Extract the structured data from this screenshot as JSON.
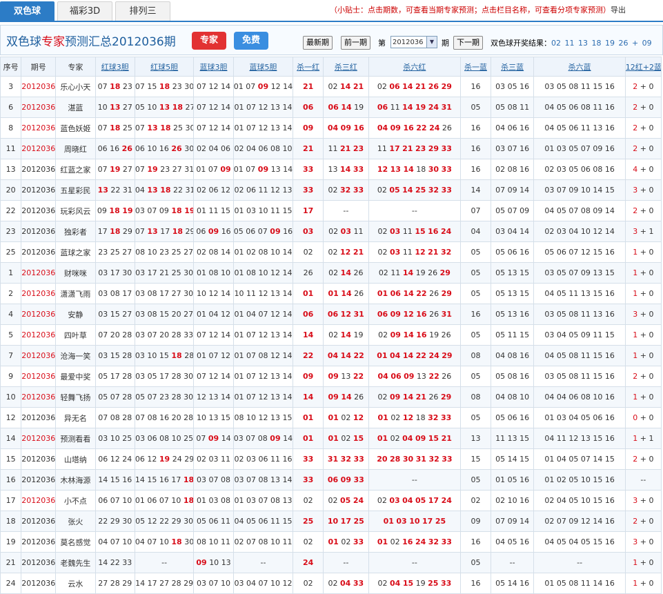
{
  "tabs": [
    "双色球",
    "福彩3D",
    "排列三"
  ],
  "tip": {
    "text": "（小贴士：点击期数，可查看当期专家预测；点击栏目名称，可查看分项专家预测）",
    "exit": "导出"
  },
  "header": {
    "title_prefix": "双色球",
    "title_red": "专家",
    "title_suffix": "预测汇总2012036期",
    "btn_expert": "专家",
    "btn_free": "免费",
    "newest": "最新期",
    "prev": "前一期",
    "di": "第",
    "period_select": "2012036",
    "qi": "期",
    "next": "下一期",
    "result_label": "双色球开奖结果：",
    "result_nums": "02 11 13 18 19 26 + 09"
  },
  "columns": [
    "序号",
    "期号",
    "专家",
    "红球3胆",
    "红球5胆",
    "蓝球3胆",
    "蓝球5胆",
    "杀一红",
    "杀三红",
    "杀六红",
    "杀一蓝",
    "杀三蓝",
    "杀六蓝",
    "12红+2蓝"
  ],
  "rows": [
    {
      "no": "3",
      "period": "2012036",
      "pred": true,
      "expert": "乐心小天",
      "r3": "07 *18 23",
      "r5": "07 15 *18 23 30",
      "b3": "07 12 14",
      "b5": "01 07 *09 12 14",
      "k1r": "*21",
      "k3r": "02 *14 *21",
      "k6r": "02 *06 *14 *21 *26 *29",
      "k1b": "16",
      "k3b": "03 05 16",
      "k6b": "03 05 08 11 15 16",
      "hit": "2 + 0"
    },
    {
      "no": "6",
      "period": "2012036",
      "pred": true,
      "expert": "湛蓝",
      "r3": "10 *13 27",
      "r5": "05 10 *13 *18 27",
      "b3": "07 12 14",
      "b5": "01 07 12 13 14",
      "k1r": "*06",
      "k3r": "*06 *14 19",
      "k6r": "*06 11 *14 *19 *24 *31",
      "k1b": "05",
      "k3b": "05 08 11",
      "k6b": "04 05 06 08 11 16",
      "hit": "2 + 0"
    },
    {
      "no": "8",
      "period": "2012036",
      "pred": true,
      "expert": "蓝色妖姬",
      "r3": "07 *18 25",
      "r5": "07 *13 *18 25 30",
      "b3": "07 12 14",
      "b5": "01 07 12 13 14",
      "k1r": "*09",
      "k3r": "*04 *09 *16",
      "k6r": "*04 *09 *16 *22 *24 26",
      "k1b": "16",
      "k3b": "04 06 16",
      "k6b": "04 05 06 11 13 16",
      "hit": "2 + 0"
    },
    {
      "no": "11",
      "period": "2012036",
      "pred": true,
      "expert": "周晓红",
      "r3": "06 16 *26",
      "r5": "06 10 16 *26 30",
      "b3": "02 04 06",
      "b5": "02 04 06 08 10",
      "k1r": "*21",
      "k3r": "11 *21 *23",
      "k6r": "11 *17 *21 *23 *29 *33",
      "k1b": "16",
      "k3b": "03 07 16",
      "k6b": "01 03 05 07 09 16",
      "hit": "2 + 0"
    },
    {
      "no": "13",
      "period": "2012036",
      "pred": false,
      "expert": "红蓝之家",
      "r3": "07 *19 27",
      "r5": "07 *19 23 27 31",
      "b3": "01 07 *09",
      "b5": "01 07 *09 13 14",
      "k1r": "*33",
      "k3r": "13 *14 *33",
      "k6r": "*12 *13 *14 18 *30 *33",
      "k1b": "16",
      "k3b": "02 08 16",
      "k6b": "02 03 05 06 08 16",
      "hit": "4 + 0"
    },
    {
      "no": "20",
      "period": "2012036",
      "pred": false,
      "expert": "五星彩民",
      "r3": "*13 22 31",
      "r5": "04 *13 *18 22 31",
      "b3": "02 06 12",
      "b5": "02 06 11 12 13",
      "k1r": "*33",
      "k3r": "02 *32 *33",
      "k6r": "02 *05 *14 *25 *32 *33",
      "k1b": "14",
      "k3b": "07 09 14",
      "k6b": "03 07 09 10 14 15",
      "hit": "3 + 0"
    },
    {
      "no": "22",
      "period": "2012036",
      "pred": false,
      "expert": "玩彩风云",
      "r3": "09 *18 *19",
      "r5": "03 07 09 *18 *19",
      "b3": "01 11 15",
      "b5": "01 03 10 11 15",
      "k1r": "*17",
      "k3r": "--",
      "k6r": "--",
      "k1b": "07",
      "k3b": "05 07 09",
      "k6b": "04 05 07 08 09 14",
      "hit": "2 + 0"
    },
    {
      "no": "23",
      "period": "2012036",
      "pred": false,
      "expert": "独彩者",
      "r3": "17 *18 29",
      "r5": "07 *13 17 *18 29",
      "b3": "06 *09 16",
      "b5": "05 06 07 *09 16",
      "k1r": "*03",
      "k3r": "02 *03 11",
      "k6r": "02 *03 11 *15 *16 *24",
      "k1b": "04",
      "k3b": "03 04 14",
      "k6b": "02 03 04 10 12 14",
      "hit": "3 + 1"
    },
    {
      "no": "25",
      "period": "2012036",
      "pred": false,
      "expert": "蓝球之家",
      "r3": "23 25 27",
      "r5": "08 10 23 25 27",
      "b3": "02 08 14",
      "b5": "01 02 08 10 14",
      "k1r": "02",
      "k3r": "02 *12 *21",
      "k6r": "02 *03 11 *12 *21 *32",
      "k1b": "05",
      "k3b": "05 06 16",
      "k6b": "05 06 07 12 15 16",
      "hit": "1 + 0"
    },
    {
      "no": "1",
      "period": "2012036",
      "pred": true,
      "expert": "财咪咪",
      "r3": "03 17 30",
      "r5": "03 17 21 25 30",
      "b3": "01 08 10",
      "b5": "01 08 10 12 14",
      "k1r": "26",
      "k3r": "02 *14 26",
      "k6r": "02 11 *14 19 26 *29",
      "k1b": "05",
      "k3b": "05 13 15",
      "k6b": "03 05 07 09 13 15",
      "hit": "1 + 0"
    },
    {
      "no": "2",
      "period": "2012036",
      "pred": true,
      "expert": "潇潇飞雨",
      "r3": "03 08 17",
      "r5": "03 08 17 27 30",
      "b3": "10 12 14",
      "b5": "10 11 12 13 14",
      "k1r": "*01",
      "k3r": "*01 *14 26",
      "k6r": "*01 *06 *14 *22 26 *29",
      "k1b": "05",
      "k3b": "05 13 15",
      "k6b": "04 05 11 13 15 16",
      "hit": "1 + 0"
    },
    {
      "no": "4",
      "period": "2012036",
      "pred": true,
      "expert": "安静",
      "r3": "03 15 27",
      "r5": "03 08 15 20 27",
      "b3": "01 04 12",
      "b5": "01 04 07 12 14",
      "k1r": "*06",
      "k3r": "*06 *12 *31",
      "k6r": "*06 *09 *12 *16 26 *31",
      "k1b": "16",
      "k3b": "05 13 16",
      "k6b": "03 05 08 11 13 16",
      "hit": "3 + 0"
    },
    {
      "no": "5",
      "period": "2012036",
      "pred": true,
      "expert": "四叶草",
      "r3": "07 20 28",
      "r5": "03 07 20 28 33",
      "b3": "07 12 14",
      "b5": "01 07 12 13 14",
      "k1r": "*14",
      "k3r": "02 *14 19",
      "k6r": "02 *09 *14 *16 19 26",
      "k1b": "05",
      "k3b": "05 11 15",
      "k6b": "03 04 05 09 11 15",
      "hit": "1 + 0"
    },
    {
      "no": "7",
      "period": "2012036",
      "pred": true,
      "expert": "沧海一笑",
      "r3": "03 15 28",
      "r5": "03 10 15 *18 28",
      "b3": "01 07 12",
      "b5": "01 07 08 12 14",
      "k1r": "*22",
      "k3r": "*04 *14 *22",
      "k6r": "*01 *04 *14 *22 *24 *29",
      "k1b": "08",
      "k3b": "04 08 16",
      "k6b": "04 05 08 11 15 16",
      "hit": "1 + 0"
    },
    {
      "no": "9",
      "period": "2012036",
      "pred": true,
      "expert": "最爱中奖",
      "r3": "05 17 28",
      "r5": "03 05 17 28 30",
      "b3": "07 12 14",
      "b5": "01 07 12 13 14",
      "k1r": "*09",
      "k3r": "*09 13 *22",
      "k6r": "*04 *06 *09 13 *22 26",
      "k1b": "05",
      "k3b": "05 08 16",
      "k6b": "03 05 08 11 15 16",
      "hit": "2 + 0"
    },
    {
      "no": "10",
      "period": "2012036",
      "pred": true,
      "expert": "轻舞飞扬",
      "r3": "05 07 28",
      "r5": "05 07 23 28 30",
      "b3": "12 13 14",
      "b5": "01 07 12 13 14",
      "k1r": "*14",
      "k3r": "*09 *14 26",
      "k6r": "02 *09 *14 *21 26 *29",
      "k1b": "08",
      "k3b": "04 08 10",
      "k6b": "04 04 06 08 10 16",
      "hit": "1 + 0"
    },
    {
      "no": "12",
      "period": "2012036",
      "pred": false,
      "expert": "异无名",
      "r3": "07 08 28",
      "r5": "07 08 16 20 28",
      "b3": "10 13 15",
      "b5": "08 10 12 13 15",
      "k1r": "*01",
      "k3r": "*01 02 *12",
      "k6r": "*01 02 *12 18 *32 *33",
      "k1b": "05",
      "k3b": "05 06 16",
      "k6b": "01 03 04 05 06 16",
      "hit": "0 + 0"
    },
    {
      "no": "14",
      "period": "2012036",
      "pred": true,
      "expert": "预测看看",
      "r3": "03 10 25",
      "r5": "03 06 08 10 25",
      "b3": "07 *09 14",
      "b5": "03 07 08 *09 14",
      "k1r": "*01",
      "k3r": "*01 02 *15",
      "k6r": "*01 02 *04 *09 *15 *21",
      "k1b": "13",
      "k3b": "11 13 15",
      "k6b": "04 11 12 13 15 16",
      "hit": "1 + 1"
    },
    {
      "no": "15",
      "period": "2012036",
      "pred": false,
      "expert": "山塔纳",
      "r3": "06 12 24",
      "r5": "06 12 *19 24 29",
      "b3": "02 03 11",
      "b5": "02 03 06 11 16",
      "k1r": "*33",
      "k3r": "*31 *32 *33",
      "k6r": "*20 *28 *30 *31 *32 *33",
      "k1b": "15",
      "k3b": "05 14 15",
      "k6b": "01 04 05 07 14 15",
      "hit": "2 + 0"
    },
    {
      "no": "16",
      "period": "2012036",
      "pred": false,
      "expert": "木林海源",
      "r3": "14 15 16",
      "r5": "14 15 16 17 *18",
      "b3": "03 07 08",
      "b5": "03 07 08 13 14",
      "k1r": "*33",
      "k3r": "*06 *09 *33",
      "k6r": "--",
      "k1b": "05",
      "k3b": "01 05 16",
      "k6b": "01 02 05 10 15 16",
      "hit": "--"
    },
    {
      "no": "17",
      "period": "2012036",
      "pred": true,
      "expert": "小不点",
      "r3": "06 07 10",
      "r5": "01 06 07 10 *18",
      "b3": "01 03 08",
      "b5": "01 03 07 08 13",
      "k1r": "02",
      "k3r": "02 *05 *24",
      "k6r": "02 *03 *04 *05 *17 *24",
      "k1b": "02",
      "k3b": "02 10 16",
      "k6b": "02 04 05 10 15 16",
      "hit": "3 + 0"
    },
    {
      "no": "18",
      "period": "2012036",
      "pred": false,
      "expert": "张火",
      "r3": "22 29 30",
      "r5": "05 12 22 29 30",
      "b3": "05 06 11",
      "b5": "04 05 06 11 15",
      "k1r": "*25",
      "k3r": "*10 *17 *25",
      "k6r": "*01 *03 *10 *17 *25",
      "k1b": "09",
      "k3b": "07 09 14",
      "k6b": "02 07 09 12 14 16",
      "hit": "2 + 0"
    },
    {
      "no": "19",
      "period": "2012036",
      "pred": false,
      "expert": "莫名感觉",
      "r3": "04 07 10",
      "r5": "04 07 10 *18 30",
      "b3": "08 10 11",
      "b5": "02 07 08 10 11",
      "k1r": "02",
      "k3r": "*01 02 *33",
      "k6r": "*01 02 *16 *24 *32 *33",
      "k1b": "16",
      "k3b": "04 05 16",
      "k6b": "04 05 04 05 15 16",
      "hit": "3 + 0"
    },
    {
      "no": "21",
      "period": "2012036",
      "pred": false,
      "expert": "老魏先生",
      "r3": "14 22 33",
      "r5": "--",
      "b3": "*09 10 13",
      "b5": "--",
      "k1r": "*24",
      "k3r": "--",
      "k6r": "--",
      "k1b": "05",
      "k3b": "--",
      "k6b": "--",
      "hit": "1 + 0"
    },
    {
      "no": "24",
      "period": "2012036",
      "pred": false,
      "expert": "云水",
      "r3": "27 28 29",
      "r5": "14 17 27 28 29",
      "b3": "03 07 10",
      "b5": "03 04 07 10 12",
      "k1r": "02",
      "k3r": "02 *04 *33",
      "k6r": "02 *04 *15 19 *25 *33",
      "k1b": "16",
      "k3b": "05 14 16",
      "k6b": "01 05 08 11 14 16",
      "hit": "1 + 0"
    }
  ]
}
